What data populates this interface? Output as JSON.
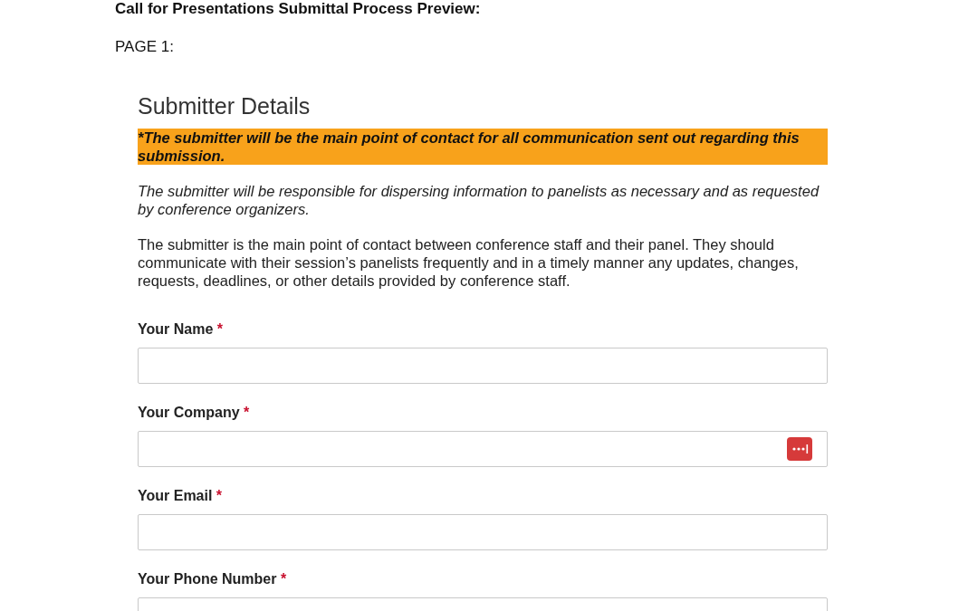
{
  "document": {
    "title": "Call for Presentations Submittal Process Preview:",
    "page_label": "PAGE 1:"
  },
  "form": {
    "heading": "Submitter Details",
    "paragraphs": [
      {
        "kind": "highlight",
        "text": "*The submitter will be the main point of contact for all communication sent out regarding this submission."
      },
      {
        "kind": "italic",
        "text": "The submitter will be responsible for dispersing information to panelists as necessary and as requested by conference organizers."
      },
      {
        "kind": "plain",
        "text": "The submitter is the main point of contact between conference staff and their panel. They should communicate with their session’s panelists frequently and in a timely manner any updates, changes, requests, deadlines, or other details provided by conference staff."
      }
    ],
    "fields": [
      {
        "label": "Your Name",
        "required_mark": "*",
        "autofill_icon": false
      },
      {
        "label": "Your Company",
        "required_mark": "*",
        "autofill_icon": true
      },
      {
        "label": "Your Email",
        "required_mark": "*",
        "autofill_icon": false
      },
      {
        "label": "Your Phone Number",
        "required_mark": "*",
        "autofill_icon": false
      }
    ]
  }
}
